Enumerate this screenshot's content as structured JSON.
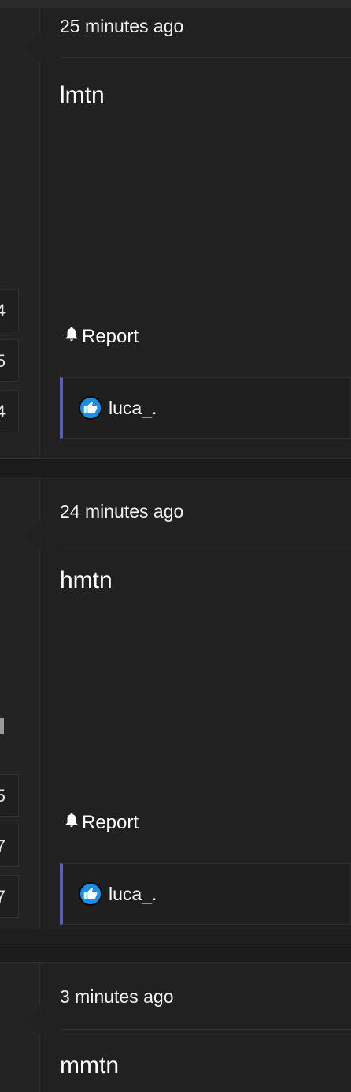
{
  "posts": [
    {
      "timestamp": "25 minutes ago",
      "text": "lmtn",
      "report_label": "Report",
      "like_user": "luca_.",
      "stats": [
        "4",
        "5",
        "4"
      ]
    },
    {
      "timestamp": "24 minutes ago",
      "text": "hmtn",
      "report_label": "Report",
      "like_user": "luca_.",
      "stats": [
        "5",
        "7",
        "7"
      ]
    },
    {
      "timestamp": "3 minutes ago",
      "text": "mmtn"
    }
  ],
  "colors": {
    "accent_border": "#5b5fbf",
    "like_icon": "#1b8fe6",
    "background": "#1e1e1e"
  },
  "icons": {
    "report": "bell-icon",
    "like": "thumbs-up-icon"
  }
}
